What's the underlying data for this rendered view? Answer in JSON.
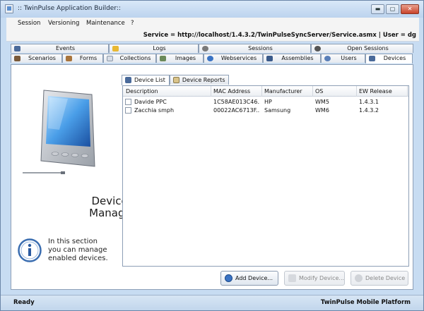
{
  "window": {
    "title": ":: TwinPulse Application Builder::",
    "controls": {
      "minimize": "▬",
      "maximize": "▢",
      "close": "✕"
    }
  },
  "menu": {
    "items": [
      "Session",
      "Versioning",
      "Maintenance",
      "?"
    ]
  },
  "service_line": "Service = http://localhost/1.4.3.2/TwinPulseSyncServer/Service.asmx  |  User = dg",
  "tabs": {
    "top_row": [
      {
        "label": "Events",
        "icon": "events-icon"
      },
      {
        "label": "Logs",
        "icon": "logs-icon"
      },
      {
        "label": "Sessions",
        "icon": "sessions-icon"
      },
      {
        "label": "Open Sessions",
        "icon": "open-sessions-icon"
      }
    ],
    "bottom_row": [
      {
        "label": "Scenarios",
        "icon": "scenarios-icon"
      },
      {
        "label": "Forms",
        "icon": "forms-icon"
      },
      {
        "label": "Collections",
        "icon": "collections-icon"
      },
      {
        "label": "Images",
        "icon": "images-icon"
      },
      {
        "label": "Webservices",
        "icon": "webservices-icon"
      },
      {
        "label": "Assemblies",
        "icon": "assemblies-icon"
      },
      {
        "label": "Users",
        "icon": "users-icon"
      },
      {
        "label": "Devices",
        "icon": "devices-icon",
        "active": true
      }
    ]
  },
  "left_panel": {
    "title_line1": "Devices",
    "title_line2": "Manager",
    "info_line1": "In this section",
    "info_line2": "you can manage",
    "info_line3": "enabled devices."
  },
  "inner_tabs": [
    {
      "label": "Device List",
      "active": true
    },
    {
      "label": "Device Reports",
      "active": false
    }
  ],
  "grid": {
    "columns": [
      "Description",
      "MAC Address",
      "Manufacturer",
      "OS",
      "EW Release"
    ],
    "rows": [
      {
        "description": "Davide PPC",
        "mac": "1C58AE013C46...",
        "manufacturer": "HP",
        "os": "WM5",
        "release": "1.4.3.1",
        "checked": false
      },
      {
        "description": "Zacchia smph",
        "mac": "00022AC6713F...",
        "manufacturer": "Samsung",
        "os": "WM6",
        "release": "1.4.3.2",
        "checked": false
      }
    ]
  },
  "buttons": {
    "add": "Add Device...",
    "modify": "Modify Device...",
    "delete": "Delete Device"
  },
  "status": {
    "left": "Ready",
    "right": "TwinPulse Mobile Platform"
  },
  "colors": {
    "accent": "#3a73c4",
    "window_frame": "#c7dcf2",
    "statusbar": "#c2d6ec"
  }
}
